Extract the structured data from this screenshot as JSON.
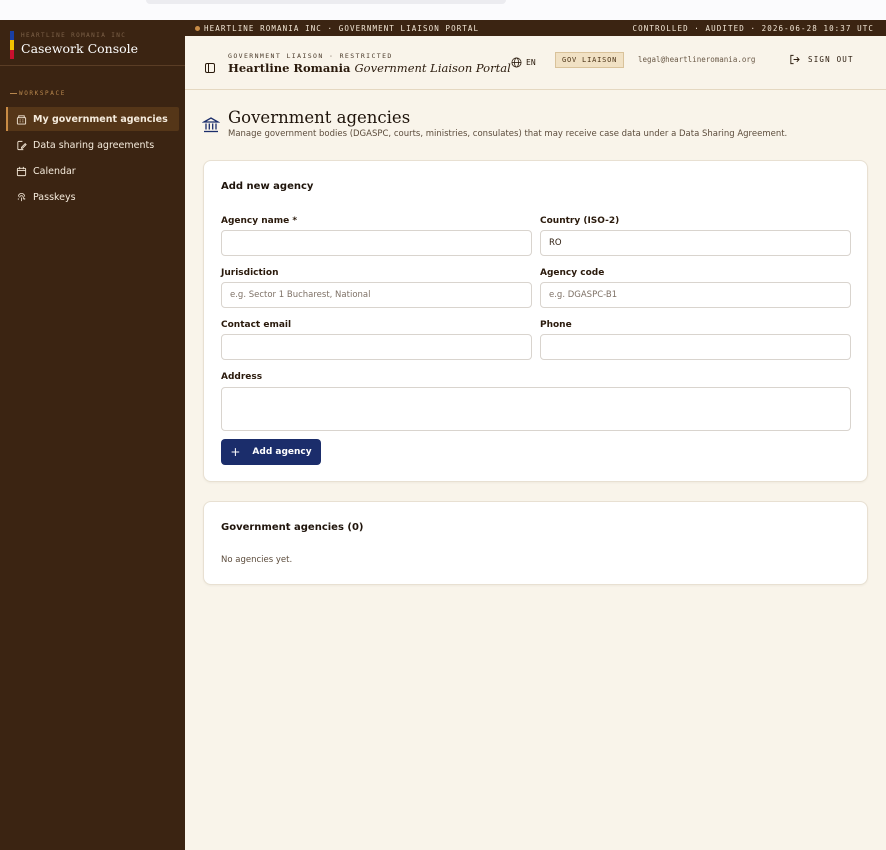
{
  "colors": {
    "sidebar_bg": "#3b2412",
    "main_bg": "#f9f4ea",
    "accent": "#c88b45",
    "primary_button": "#1b2d6b",
    "flag": [
      "#1a3fa3",
      "#f2c200",
      "#c8102e"
    ]
  },
  "sidebar": {
    "brand_small": "HEARTLINE ROMANIA INC",
    "brand_title": "Casework Console",
    "section_label": "WORKSPACE",
    "items": [
      {
        "label": "My government agencies",
        "icon": "building-icon",
        "active": true
      },
      {
        "label": "Data sharing agreements",
        "icon": "document-edit-icon",
        "active": false
      },
      {
        "label": "Calendar",
        "icon": "calendar-icon",
        "active": false
      },
      {
        "label": "Passkeys",
        "icon": "fingerprint-icon",
        "active": false
      }
    ]
  },
  "audit_bar": {
    "left": "HEARTLINE ROMANIA INC · GOVERNMENT LIAISON PORTAL",
    "right": "CONTROLLED · AUDITED · 2026-06-28 10:37 UTC"
  },
  "header": {
    "portal_small": "GOVERNMENT LIAISON · RESTRICTED",
    "portal_title_main": "Heartline Romania",
    "portal_title_italic": "Government Liaison Portal",
    "language": "EN",
    "role_badge": "GOV LIAISON",
    "user_email": "legal@heartlineromania.org",
    "sign_out": "SIGN OUT"
  },
  "page": {
    "title": "Government agencies",
    "description": "Manage government bodies (DGASPC, courts, ministries, consulates) that may receive case data under a Data Sharing Agreement."
  },
  "form": {
    "title": "Add new agency",
    "fields": {
      "agency_name": {
        "label": "Agency name *",
        "value": "",
        "placeholder": ""
      },
      "country": {
        "label": "Country (ISO-2)",
        "value": "RO",
        "placeholder": ""
      },
      "jurisdiction": {
        "label": "Jurisdiction",
        "value": "",
        "placeholder": "e.g. Sector 1 Bucharest, National"
      },
      "agency_code": {
        "label": "Agency code",
        "value": "",
        "placeholder": "e.g. DGASPC-B1"
      },
      "contact_email": {
        "label": "Contact email",
        "value": "",
        "placeholder": ""
      },
      "phone": {
        "label": "Phone",
        "value": "",
        "placeholder": ""
      },
      "address": {
        "label": "Address",
        "value": "",
        "placeholder": ""
      }
    },
    "submit_label": "Add agency"
  },
  "list": {
    "title": "Government agencies (0)",
    "empty_text": "No agencies yet."
  }
}
